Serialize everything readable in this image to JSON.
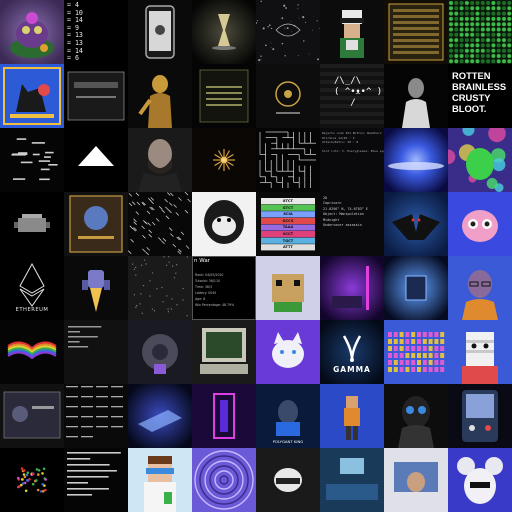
{
  "gallery": {
    "tiles": {
      "eq_list": [
        "= 4",
        "= 10",
        "= 14",
        "= 9",
        "= 13",
        "= 13",
        "= 14",
        "= 6"
      ],
      "rotten_text": [
        "ROTTEN",
        "BRAINLESS",
        "CRUSTY",
        "BLOOT."
      ],
      "glyph_text": [
        "/\\_/\\",
        "( ^•ᴥ•^ )",
        "   /   "
      ],
      "ethereum_label": "ETHEREUM",
      "gamma_label": "GAMMA",
      "nwar_title": "n War",
      "nwar_lines": [
        "Rank: 04/05/2020",
        "Tutorial: 36/110",
        "Time: 38/3",
        "Lottery: 0045",
        "Age: 8",
        "Win Percentage: 48.79%"
      ],
      "coords_lines": [
        "28",
        "Capricorn",
        "21.0296° N, 74.6783° E",
        "Object: Manipulation",
        "Midnight",
        "Undercover assassin"
      ],
      "color_labels": [
        "8TCT",
        "GTCT",
        "8CIA",
        "GCCS",
        "TAAA",
        "9CCT",
        "TGCT",
        "ATTT"
      ],
      "data_text_lines": [
        "Rejects code 301 Button: Weatherx",
        "Hit/miss 14/40 : 2",
        "Attack/Ratio: 28 : 8",
        "",
        "Slot info: V. Everygleaze: Blue eyes blue eye"
      ],
      "polyhat_label": "POLYGANT KING"
    }
  },
  "colors": {
    "bg": "#000000",
    "tile_dark": "#0b0b0d",
    "blue_accent": "#2d5bd8",
    "purple_accent": "#6b3fd0",
    "green_pixel": "#3a9a3a"
  }
}
